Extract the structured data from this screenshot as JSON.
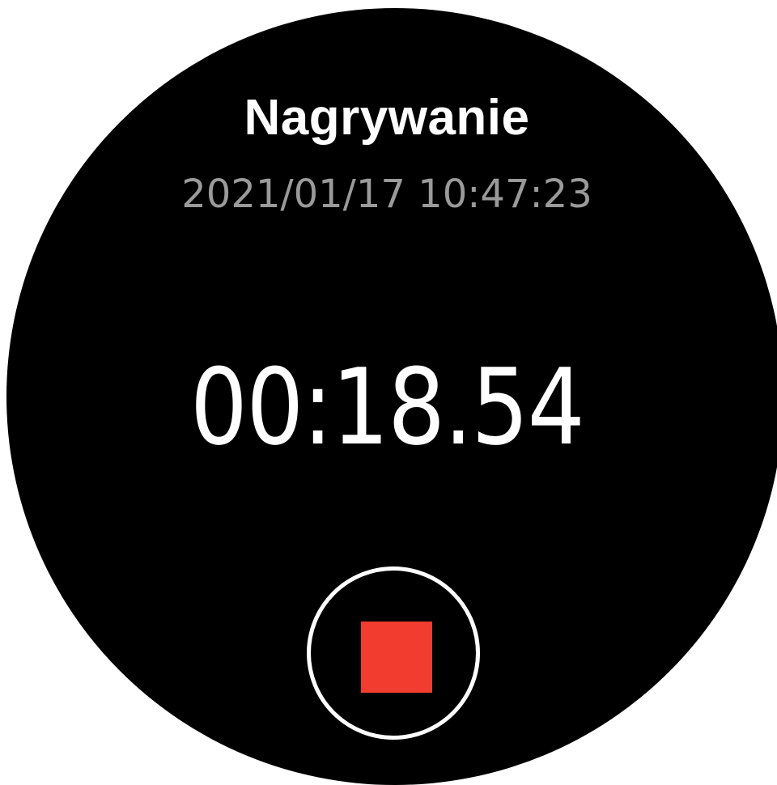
{
  "recording": {
    "title": "Nagrywanie",
    "timestamp": "2021/01/17 10:47:23",
    "elapsed": "00:18.54"
  },
  "controls": {
    "stop_icon": "stop-square-icon"
  },
  "colors": {
    "background": "#000000",
    "title": "#ffffff",
    "timestamp": "#9a9a9a",
    "timer": "#ffffff",
    "stop_accent": "#f33c30"
  }
}
